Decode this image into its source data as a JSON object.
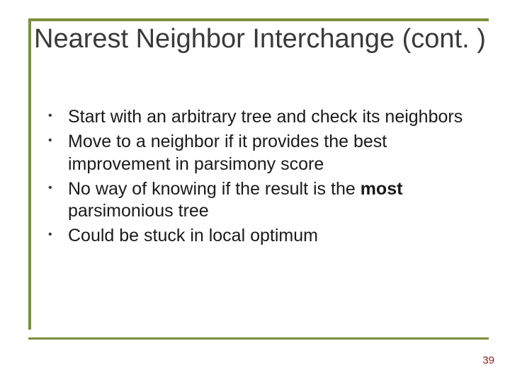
{
  "slide": {
    "title": "Nearest Neighbor Interchange (cont. )",
    "bullets": [
      {
        "prefix": "Start with an arbitrary tree and check its neighbors",
        "bold": "",
        "suffix": ""
      },
      {
        "prefix": "Move to a neighbor if it provides the best improvement in parsimony score",
        "bold": "",
        "suffix": ""
      },
      {
        "prefix": "No way of knowing if the result is the ",
        "bold": "most",
        "suffix": " parsimonious tree"
      },
      {
        "prefix": "Could be stuck in local optimum",
        "bold": "",
        "suffix": ""
      }
    ],
    "page_number": "39"
  }
}
